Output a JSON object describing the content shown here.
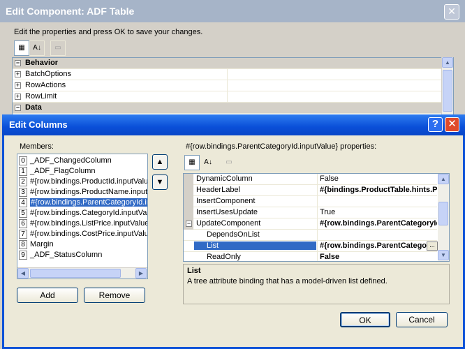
{
  "background_window": {
    "title": "Edit Component: ADF Table",
    "close_glyph": "✕",
    "instructions": "Edit the properties and press OK to save your changes.",
    "categories": [
      {
        "label": "Behavior",
        "expander": "⊟",
        "type": "category"
      },
      {
        "label": "BatchOptions",
        "expander": "⊞",
        "type": "item"
      },
      {
        "label": "RowActions",
        "expander": "⊞",
        "type": "item"
      },
      {
        "label": "RowLimit",
        "expander": "⊞",
        "type": "item"
      },
      {
        "label": "Data",
        "expander": "⊟",
        "type": "category"
      }
    ]
  },
  "dialog": {
    "title": "Edit Columns",
    "help_glyph": "?",
    "close_glyph": "✕",
    "members_label": "Members:",
    "members": [
      {
        "index": "0",
        "label": "_ADF_ChangedColumn"
      },
      {
        "index": "1",
        "label": "_ADF_FlagColumn"
      },
      {
        "index": "2",
        "label": "#{row.bindings.ProductId.inputValue}"
      },
      {
        "index": "3",
        "label": "#{row.bindings.ProductName.inputValue}"
      },
      {
        "index": "4",
        "label": "#{row.bindings.ParentCategoryId.inputValue}",
        "selected": true
      },
      {
        "index": "5",
        "label": "#{row.bindings.CategoryId.inputValue}"
      },
      {
        "index": "6",
        "label": "#{row.bindings.ListPrice.inputValue}"
      },
      {
        "index": "7",
        "label": "#{row.bindings.CostPrice.inputValue}"
      },
      {
        "index": "8",
        "label": "Margin"
      },
      {
        "index": "9",
        "label": "_ADF_StatusColumn"
      }
    ],
    "move_up_glyph": "▲",
    "move_down_glyph": "▼",
    "add_label": "Add",
    "remove_label": "Remove",
    "properties_label": "#{row.bindings.ParentCategoryId.inputValue} properties:",
    "properties": [
      {
        "name": "DynamicColumn",
        "value": "False",
        "bold": false
      },
      {
        "name": "HeaderLabel",
        "value": "#{bindings.ProductTable.hints.ParentCategoryId.label}",
        "bold": true
      },
      {
        "name": "InsertComponent",
        "value": "",
        "bold": false
      },
      {
        "name": "InsertUsesUpdate",
        "value": "True",
        "bold": false
      },
      {
        "name": "UpdateComponent",
        "value": "#{row.bindings.ParentCategoryId.inputValue}",
        "bold": true,
        "expander": "⊟"
      },
      {
        "name": "DependsOnList",
        "value": "",
        "bold": false,
        "child": true
      },
      {
        "name": "List",
        "value": "#{row.bindings.ParentCategoryId.inputValue}",
        "bold": true,
        "child": true,
        "selected": true,
        "ellipsis": "..."
      },
      {
        "name": "ReadOnly",
        "value": "False",
        "bold": true,
        "child": true
      }
    ],
    "description": {
      "title": "List",
      "text": "A tree attribute binding that has a model-driven list defined."
    },
    "ok_label": "OK",
    "cancel_label": "Cancel"
  },
  "colors": {
    "title_bar": "#0a4fd8",
    "selection": "#316ac5",
    "dialog_face": "#ece9d8"
  }
}
